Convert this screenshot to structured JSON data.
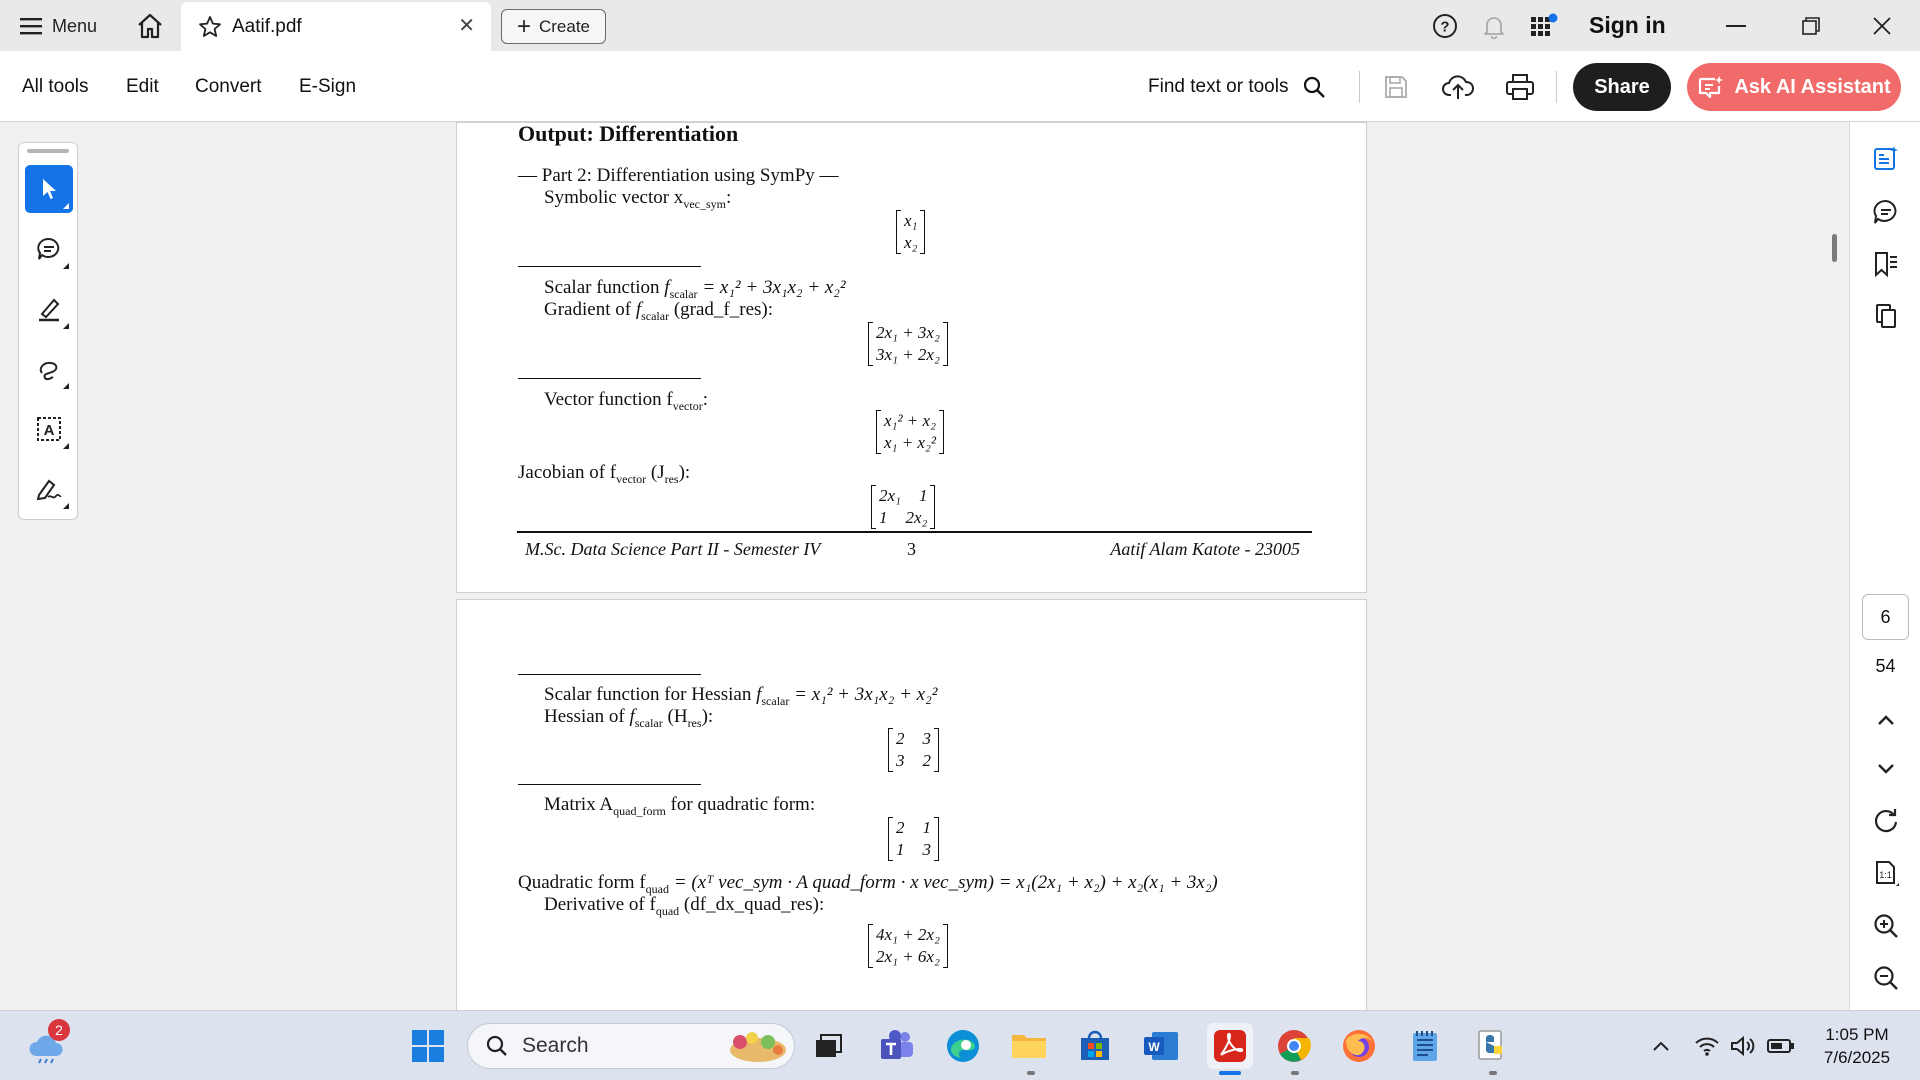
{
  "tabbar": {
    "menu_label": "Menu",
    "doc_tab_title": "Aatif.pdf",
    "create_label": "Create",
    "sign_in_label": "Sign in"
  },
  "toolbar": {
    "all_tools": "All tools",
    "edit": "Edit",
    "convert": "Convert",
    "esign": "E-Sign",
    "find_label": "Find text or tools",
    "share_label": "Share",
    "ai_label": "Ask AI Assistant"
  },
  "colors": {
    "accent_blue": "#1473e6",
    "ai_button": "#f26b6b",
    "share_button": "#1e1e1e"
  },
  "navigation": {
    "current_page": "6",
    "total_pages": "54"
  },
  "page1": {
    "heading": "Output: Differentiation",
    "part_title": "— Part 2: Differentiation using SymPy —",
    "symbolic_vector_label": "Symbolic vector x",
    "symbolic_vector_sub": "vec_sym",
    "symbolic_vector_matrix": [
      [
        "x₁"
      ],
      [
        "x₂"
      ]
    ],
    "scalar_function_label": "Scalar function",
    "scalar_function_sub": "scalar",
    "scalar_function_expr": "= x₁² + 3x₁x₂ + x₂²",
    "gradient_label": "Gradient of",
    "gradient_sub": "scalar",
    "gradient_suffix": "(grad_f_res):",
    "gradient_matrix": [
      [
        "2x₁ + 3x₂"
      ],
      [
        "3x₁ + 2x₂"
      ]
    ],
    "vector_function_label": "Vector function f",
    "vector_function_sub": "vector",
    "vector_function_matrix": [
      [
        "x₁² + x₂"
      ],
      [
        "x₁ + x₂²"
      ]
    ],
    "jacobian_label": "Jacobian of f",
    "jacobian_sub": "vector",
    "jacobian_suffix": "(J",
    "jacobian_res_sub": "res",
    "jacobian_matrix": [
      [
        "2x₁",
        "1"
      ],
      [
        "1",
        "2x₂"
      ]
    ],
    "footer_left": "M.Sc. Data Science Part II - Semester IV",
    "footer_page": "3",
    "footer_right": "Aatif Alam Katote - 23005"
  },
  "page2": {
    "hessian_scalar_label": "Scalar function for Hessian",
    "hessian_scalar_sub": "scalar",
    "hessian_scalar_expr": "= x₁² + 3x₁x₂ + x₂²",
    "hessian_label": "Hessian of",
    "hessian_sub": "scalar",
    "hessian_suffix": "(H",
    "hessian_res_sub": "res",
    "hessian_matrix": [
      [
        "2",
        "3"
      ],
      [
        "3",
        "2"
      ]
    ],
    "quad_matrix_label": "Matrix A",
    "quad_matrix_sub": "quad_form",
    "quad_matrix_suffix": "for quadratic form:",
    "quad_matrix": [
      [
        "2",
        "1"
      ],
      [
        "1",
        "3"
      ]
    ],
    "quad_form_label": "Quadratic form f",
    "quad_form_sub": "quad",
    "quad_form_expr": "= (xᵀ vec_sym · A quad_form · x vec_sym) = x₁(2x₁ + x₂) + x₂(x₁ + 3x₂)",
    "derivative_label": "Derivative of f",
    "derivative_sub": "quad",
    "derivative_suffix": "(df_dx_quad_res):",
    "derivative_matrix": [
      [
        "4x₁ + 2x₂"
      ],
      [
        "2x₁ + 6x₂"
      ]
    ]
  },
  "taskbar": {
    "weather_badge": "2",
    "search_placeholder": "Search",
    "time": "1:05 PM",
    "date": "7/6/2025"
  }
}
